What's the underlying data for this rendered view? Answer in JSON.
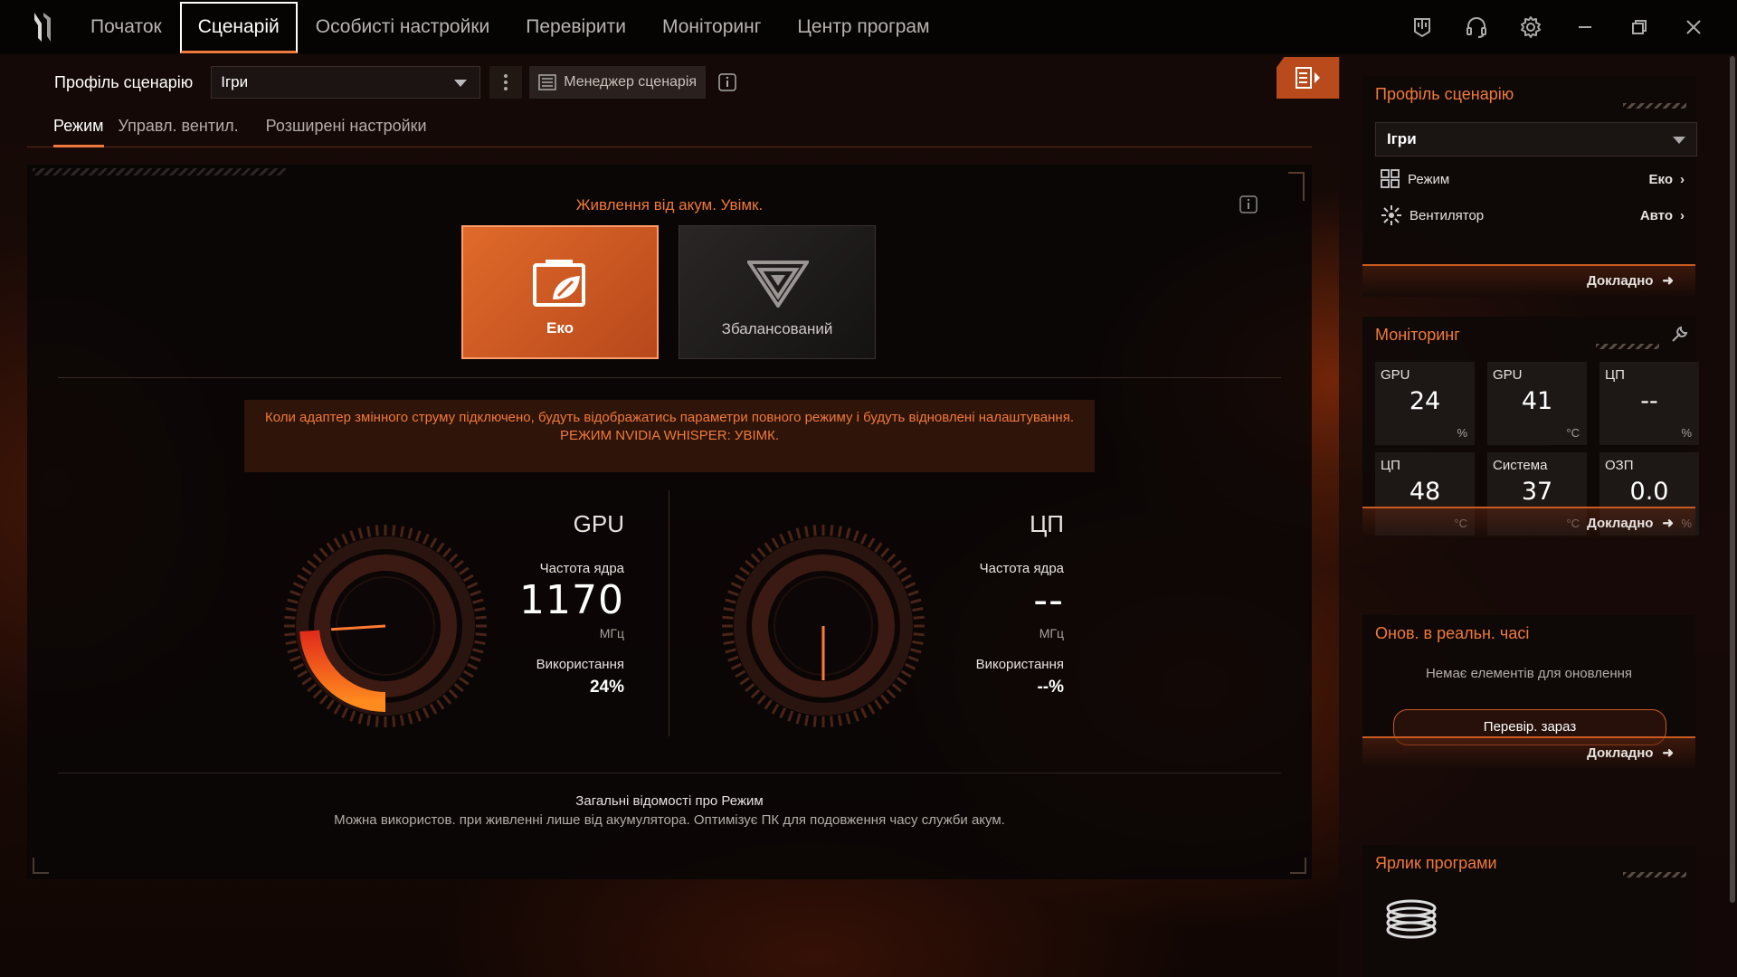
{
  "nav": {
    "items": [
      "Початок",
      "Сценарій",
      "Особисті настройки",
      "Перевірити",
      "Моніторинг",
      "Центр програм"
    ],
    "active_index": 1
  },
  "window_icons": [
    "device-icon",
    "headset-icon",
    "gear-icon",
    "minimize-icon",
    "restore-icon",
    "close-icon"
  ],
  "profile": {
    "label": "Профіль сценарію",
    "value": "Ігри",
    "manager_label": "Менеджер сценарія"
  },
  "subtabs": [
    "Режим",
    "Управл. вентил.",
    "Розширені настройки"
  ],
  "mode_panel": {
    "battery_text": "Живлення від акум. Увімк.",
    "modes": [
      {
        "label": "Еко",
        "selected": true
      },
      {
        "label": "Збалансований",
        "selected": false
      }
    ],
    "warning_line1": "Коли адаптер змінного струму підключено, будуть відображатись параметри повного режиму і будуть відновлені налаштування.",
    "warning_line2": "РЕЖИМ NVIDIA WHISPER: УВІМК.",
    "about_title": "Загальні відомості про Режим",
    "about_desc": "Можна використов. при живленні лише від акумулятора. Оптимізує ПК для подовження часу служби акум."
  },
  "gpu": {
    "title": "GPU",
    "freq_label": "Частота ядра",
    "freq_value": "1170",
    "freq_unit": "МГц",
    "usage_label": "Використання",
    "usage_value": "24%",
    "usage_fraction": 0.24
  },
  "cpu": {
    "title": "ЦП",
    "freq_label": "Частота ядра",
    "freq_value": "--",
    "freq_unit": "МГц",
    "usage_label": "Використання",
    "usage_value": "--%",
    "usage_fraction": 0
  },
  "sidebar": {
    "profile_card": {
      "title": "Профіль сценарію",
      "select_value": "Ігри",
      "rows": [
        {
          "label": "Режим",
          "value": "Еко"
        },
        {
          "label": "Вентилятор",
          "value": "Авто"
        }
      ],
      "more": "Докладно"
    },
    "monitor_card": {
      "title": "Моніторинг",
      "cells": [
        {
          "label": "GPU",
          "value": "24",
          "unit": "%"
        },
        {
          "label": "GPU",
          "value": "41",
          "unit": "°C"
        },
        {
          "label": "ЦП",
          "value": "--",
          "unit": "%"
        },
        {
          "label": "ЦП",
          "value": "48",
          "unit": "°C"
        },
        {
          "label": "Система",
          "value": "37",
          "unit": "°C"
        },
        {
          "label": "ОЗП",
          "value": "0.0",
          "unit": "%"
        }
      ],
      "more": "Докладно"
    },
    "update_card": {
      "title": "Онов. в реальн. часі",
      "empty_text": "Немає елементів для оновлення",
      "check_button": "Перевір. зараз",
      "more": "Докладно"
    },
    "shortcut_card": {
      "title": "Ярлик програми"
    }
  },
  "colors": {
    "accent": "#f07a3a",
    "eco_card": "#d0602a"
  }
}
